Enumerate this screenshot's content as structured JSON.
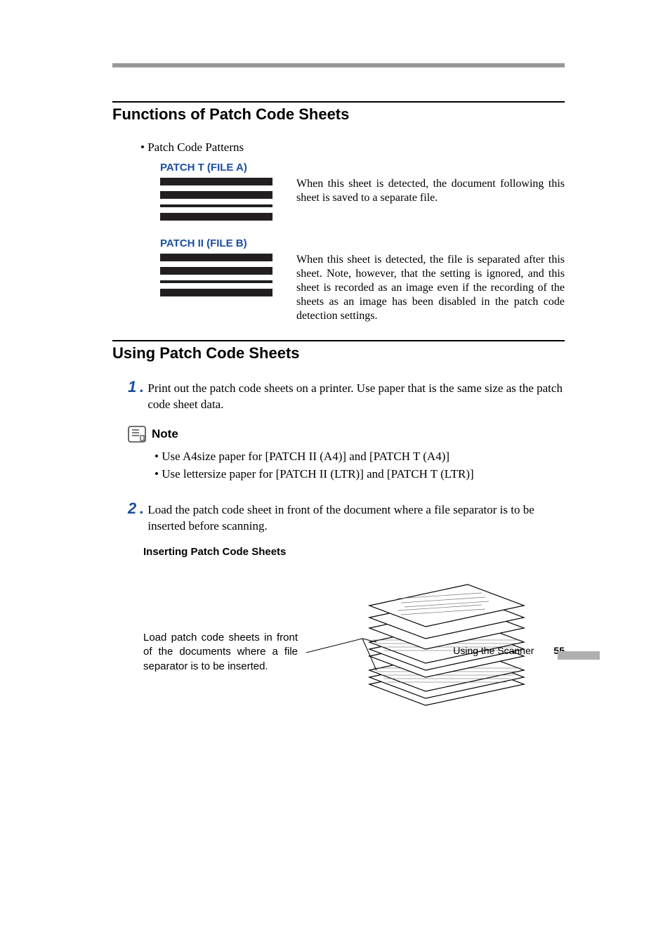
{
  "section1": {
    "title": "Functions of Patch Code Sheets",
    "patternsLabel": "•  Patch Code Patterns",
    "patchT": {
      "title": "PATCH T (FILE A)",
      "desc": "When this sheet is detected, the document following this sheet is saved to a separate file."
    },
    "patchII": {
      "title": "PATCH II (FILE B)",
      "desc": "When this sheet is detected, the file is separated after this sheet. Note, however, that the setting is ignored, and this sheet is recorded as an image even if the recording of the sheets as an image has been disabled in the patch code detection settings."
    }
  },
  "section2": {
    "title": "Using Patch Code Sheets",
    "step1": {
      "num": "1",
      "text": "Print out the patch code sheets on a printer. Use paper that is the same size as the patch code sheet data."
    },
    "note": {
      "label": "Note",
      "b1": "•  Use A4size paper for [PATCH II (A4)] and [PATCH T (A4)]",
      "b2": "•  Use lettersize paper for [PATCH II (LTR)] and [PATCH T (LTR)]"
    },
    "step2": {
      "num": "2",
      "text": "Load the patch code sheet in front of the document where a file separator is to be inserted before scanning."
    },
    "insertTitle": "Inserting Patch Code Sheets",
    "diagCaption": "Load patch code sheets in front of the documents where a file separator is to be inserted."
  },
  "footer": {
    "text": "Using the Scanner",
    "page": "55"
  }
}
